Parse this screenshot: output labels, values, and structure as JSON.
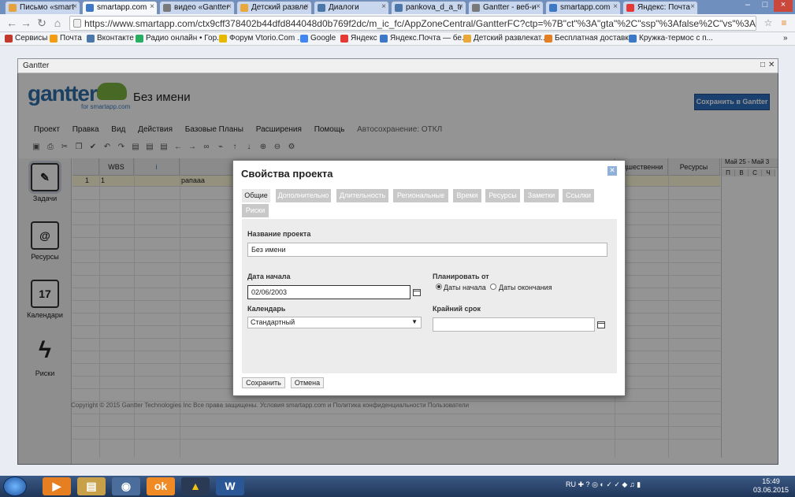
{
  "browser": {
    "tabs": [
      {
        "label": "Письмо «smart",
        "active": false,
        "color": "#e6a23c"
      },
      {
        "label": "smartapp.com",
        "active": true,
        "color": "#3d78c7"
      },
      {
        "label": "видео «Gantter",
        "active": false,
        "color": "#7a7a7a"
      },
      {
        "label": "Детский развле",
        "active": false,
        "color": "#e9a83a"
      },
      {
        "label": "Диалоги",
        "active": false,
        "color": "#4a76a8"
      },
      {
        "label": "pankova_d_a_tr",
        "active": false,
        "color": "#4a76a8"
      },
      {
        "label": "Gantter - веб-и",
        "active": false,
        "color": "#7a7a7a"
      },
      {
        "label": "smartapp.com",
        "active": false,
        "color": "#3d78c7"
      },
      {
        "label": "Яндекс: Почта",
        "active": false,
        "color": "#e53935"
      }
    ],
    "url": "https://www.smartapp.com/ctx9cff378402b44dfd844048d0b769f2dc/m_ic_fc/AppZoneCentral/GantterFC?ctp=%7B\"ct\"%3A\"gta\"%2C\"ssp\"%3Afalse%2C\"vs\"%3Atrue%7D",
    "bookmarks": [
      {
        "label": "Сервисы",
        "color": "#c0392b"
      },
      {
        "label": "Почта",
        "color": "#f39c12"
      },
      {
        "label": "Вконтакте",
        "color": "#4a76a8"
      },
      {
        "label": "Радио онлайн • Гор...",
        "color": "#27ae60"
      },
      {
        "label": "Форум Vtorio.Com ...",
        "color": "#e6b800"
      },
      {
        "label": "Google",
        "color": "#4285f4"
      },
      {
        "label": "Яндекс",
        "color": "#e53935"
      },
      {
        "label": "Яндекс.Почта — бе...",
        "color": "#3d78c7"
      },
      {
        "label": "Детский развлекат...",
        "color": "#e9a83a"
      },
      {
        "label": "Бесплатная доставк...",
        "color": "#e67e22"
      },
      {
        "label": "Кружка-термос с п...",
        "color": "#3d78c7"
      }
    ]
  },
  "app_window": {
    "title": "Gantter",
    "logo": "gantter",
    "logo_sub": "for smartapp.com",
    "project_name": "Без имени",
    "save_button": "Сохранить в Gantter",
    "menu": [
      "Проект",
      "Правка",
      "Вид",
      "Действия",
      "Базовые Планы",
      "Расширения",
      "Помощь"
    ],
    "autosave": "Автосохранение: ОТКЛ",
    "left_panel": [
      {
        "label": "Задачи",
        "icon": "tasks-icon",
        "glyph": "✎"
      },
      {
        "label": "Ресурсы",
        "icon": "resources-icon",
        "glyph": "@"
      },
      {
        "label": "Календари",
        "icon": "calendar-icon",
        "glyph": "17"
      },
      {
        "label": "Риски",
        "icon": "risks-icon",
        "glyph": "ϟ"
      }
    ],
    "grid": {
      "headers": [
        "WBS",
        "i",
        "",
        "едшественни",
        "Ресурсы"
      ],
      "row": {
        "num": "1",
        "wbs": "1",
        "name": "рапааа"
      }
    },
    "gantt": {
      "month": "Май 25 - Май 3",
      "days": [
        "П",
        "В",
        "С",
        "Ч"
      ]
    },
    "footer": "Copyright © 2015   Gantter Technologies Inc    Все права защищены.   Условия smartapp.com и Политика конфиденциальности   Пользователи"
  },
  "dialog": {
    "title": "Свойства проекта",
    "tabs": [
      "Общие",
      "Дополнительно",
      "Длительность",
      "Региональные",
      "Время",
      "Ресурсы",
      "Заметки",
      "Ссылки",
      "Риски"
    ],
    "project_name_label": "Название проекта",
    "project_name_value": "Без имени",
    "start_date_label": "Дата начала",
    "start_date_value": "02/06/2003",
    "schedule_from_label": "Планировать от",
    "schedule_from_options": [
      "Даты начала",
      "Даты окончания"
    ],
    "schedule_from_selected": "Даты начала",
    "calendar_label": "Календарь",
    "calendar_value": "Стандартный",
    "deadline_label": "Крайний срок",
    "deadline_value": "",
    "save_label": "Сохранить",
    "cancel_label": "Отмена"
  },
  "taskbar": {
    "lang": "RU",
    "time": "15:49",
    "date": "03.06.2015"
  }
}
